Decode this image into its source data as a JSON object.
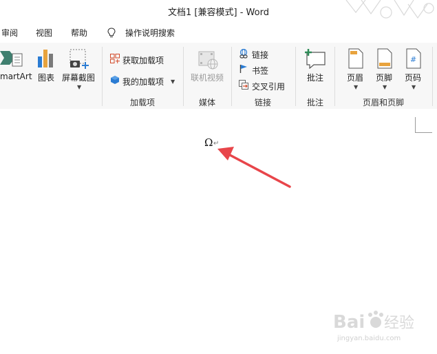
{
  "window": {
    "title": "文档1 [兼容模式]  -  Word"
  },
  "menu": {
    "items": [
      "审阅",
      "视图",
      "帮助"
    ],
    "tell_me": "操作说明搜索",
    "tell_me_icon": "lightbulb-icon"
  },
  "ribbon": {
    "smartart": "martArt",
    "chart": "图表",
    "screenshot": "屏幕截图",
    "get_addins": "获取加载项",
    "my_addins": "我的加载项",
    "online_video": "联机视频",
    "link": "链接",
    "bookmark": "书签",
    "cross_ref": "交叉引用",
    "comment": "批注",
    "header": "页眉",
    "footer": "页脚",
    "page_number": "页码",
    "groups": {
      "addins": "加载项",
      "media": "媒体",
      "links": "链接",
      "comments": "批注",
      "header_footer": "页眉和页脚"
    }
  },
  "document": {
    "symbol": "Ω",
    "paragraph_mark": "↵"
  },
  "watermark": {
    "brand": "Bai",
    "brand2": "经验",
    "url": "jingyan.baidu.com"
  },
  "colors": {
    "arrow": "#e8454a",
    "accent_blue": "#2b7cd3",
    "accent_green": "#2e8b57"
  }
}
